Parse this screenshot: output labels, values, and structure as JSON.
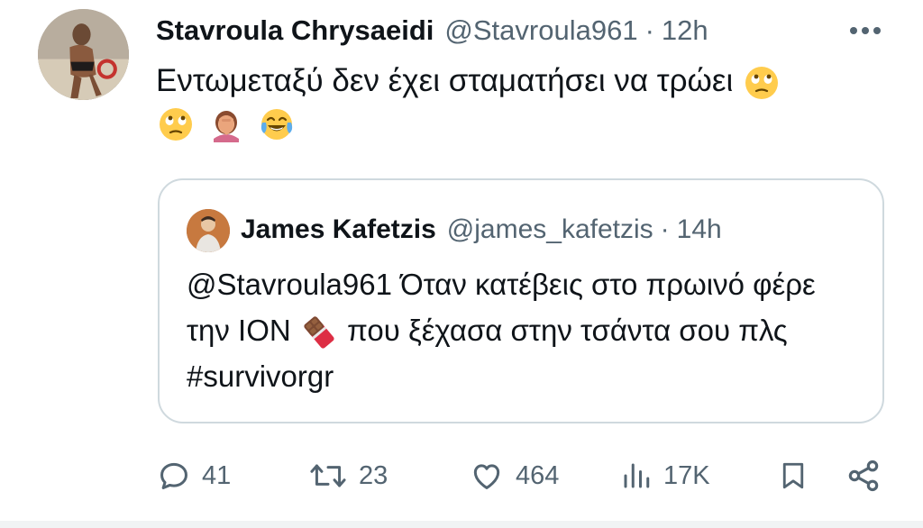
{
  "tweet": {
    "display_name": "Stavroula Chrysaeidi",
    "handle": "@Stavroula961",
    "separator": "·",
    "time": "12h",
    "text": "Εντωμεταξύ δεν έχει σταματήσει να τρώει"
  },
  "quote": {
    "display_name": "James Kafetzis",
    "handle": "@james_kafetzis",
    "separator": "·",
    "time": "14h",
    "mention": "@Stavroula961",
    "text_part1": " Όταν κατέβεις στο πρωινό φέρε την ΙΟΝ ",
    "text_part2": " που ξέχασα στην τσάντα σου πλς ",
    "hashtag": "#survivorgr"
  },
  "actions": {
    "replies": "41",
    "reposts": "23",
    "likes": "464",
    "views": "17K"
  },
  "colors": {
    "text_primary": "#0f1419",
    "text_secondary": "#536471",
    "border": "#cfd9de"
  },
  "icons": [
    "more-icon",
    "reply-icon",
    "repost-icon",
    "like-icon",
    "views-icon",
    "bookmark-icon",
    "share-icon",
    "eye-roll-emoji",
    "facepalm-emoji",
    "tears-of-joy-emoji",
    "chocolate-emoji"
  ]
}
